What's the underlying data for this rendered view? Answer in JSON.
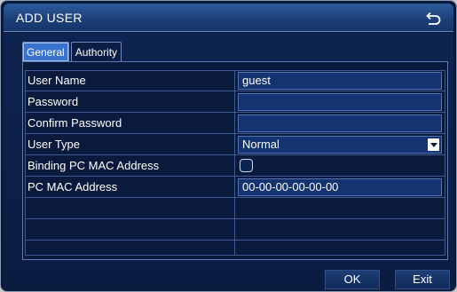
{
  "window": {
    "title": "ADD USER",
    "back_icon": "back-arrow-icon"
  },
  "tabs": [
    {
      "label": "General",
      "active": true
    },
    {
      "label": "Authority",
      "active": false
    }
  ],
  "form": {
    "rows": [
      {
        "label": "User Name",
        "value": "guest",
        "type": "text"
      },
      {
        "label": "Password",
        "value": "",
        "type": "password"
      },
      {
        "label": "Confirm Password",
        "value": "",
        "type": "password"
      },
      {
        "label": "User Type",
        "value": "Normal",
        "type": "select"
      },
      {
        "label": "Binding PC MAC Address",
        "checked": false,
        "type": "checkbox"
      },
      {
        "label": "PC MAC Address",
        "value": "00-00-00-00-00-00",
        "type": "text"
      }
    ]
  },
  "buttons": {
    "ok": "OK",
    "exit": "Exit"
  },
  "colors": {
    "title_bar": "#1c3f78",
    "background": "#0a1a3a",
    "active_tab": "#3a72d0",
    "field": "#13346e"
  }
}
